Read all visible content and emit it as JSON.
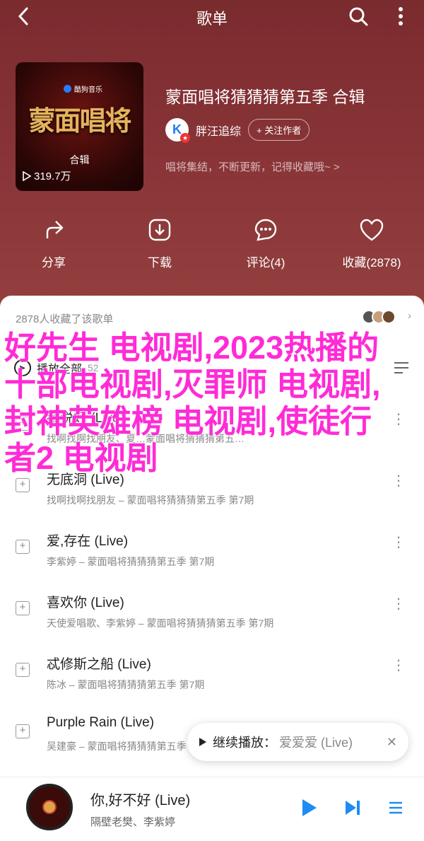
{
  "header": {
    "title": "歌单"
  },
  "album": {
    "title": "蒙面唱将猜猜猜第五季 合辑",
    "cover_brand": "酷狗音乐",
    "cover_art_text": "蒙面唱将",
    "cover_tag": "合辑",
    "play_count": "319.7万",
    "owner_name": "胖汪追综",
    "follow_label": "+ 关注作者",
    "description": "唱将集结，不断更新，记得收藏哦~ >"
  },
  "actions": [
    {
      "label": "分享",
      "icon": "share-icon"
    },
    {
      "label": "下载",
      "icon": "download-icon"
    },
    {
      "label": "评论(4)",
      "icon": "comment-icon"
    },
    {
      "label": "收藏(2878)",
      "icon": "heart-icon"
    }
  ],
  "collectors": {
    "text": "2878人收藏了该歌单"
  },
  "playall": {
    "label": "播放全部",
    "count": "52"
  },
  "songs": [
    {
      "name": "都说好 (Live)",
      "meta": "找啊找啊找朋友、夏…蒙面唱将猜猜猜第五…"
    },
    {
      "name": "无底洞 (Live)",
      "meta": "找啊找啊找朋友 – 蒙面唱将猜猜猜第五季 第7期"
    },
    {
      "name": "爱,存在 (Live)",
      "meta": "李紫婷 – 蒙面唱将猜猜猜第五季 第7期"
    },
    {
      "name": "喜欢你 (Live)",
      "meta": "天使爱唱歌、李紫婷 – 蒙面唱将猜猜猜第五季 第7期"
    },
    {
      "name": "忒修斯之船 (Live)",
      "meta": "陈冰 – 蒙面唱将猜猜猜第五季 第7期"
    },
    {
      "name": "Purple Rain (Live)",
      "meta": "吴建豪 – 蒙面唱将猜猜猜第五季"
    }
  ],
  "resume": {
    "label": "继续播放：",
    "track": "爱爱爱 (Live)"
  },
  "player": {
    "name": "你,好不好 (Live)",
    "artist": "隔壁老樊、李紫婷"
  },
  "overlay": {
    "text": "好先生 电视剧,2023热播的十部电视剧,灭罪师 电视剧,封神英雄榜 电视剧,使徒行者2 电视剧"
  },
  "colors": {
    "hero": "#8a3538",
    "accent": "#2a7bff",
    "overlay": "#ff2bd6"
  }
}
